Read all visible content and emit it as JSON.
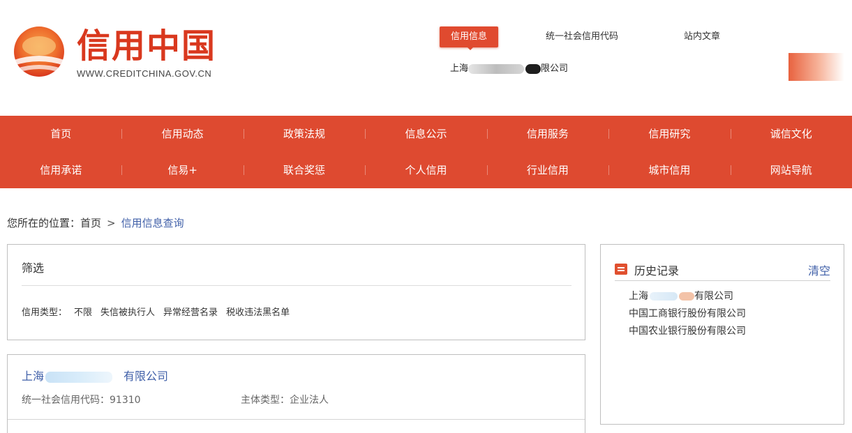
{
  "header": {
    "logo_title": "信用中国",
    "logo_url": "WWW.CREDITCHINA.GOV.CN"
  },
  "search": {
    "tabs": [
      "信用信息",
      "统一社会信用代码",
      "站内文章"
    ],
    "active_tab": 0,
    "value_prefix": "上海",
    "value_suffix": "限公司"
  },
  "nav": {
    "row1": [
      "首页",
      "信用动态",
      "政策法规",
      "信息公示",
      "信用服务",
      "信用研究",
      "诚信文化"
    ],
    "row2": [
      "信用承诺",
      "信易+",
      "联合奖惩",
      "个人信用",
      "行业信用",
      "城市信用",
      "网站导航"
    ]
  },
  "breadcrumb": {
    "prefix": "您所在的位置：",
    "home": "首页",
    "separator": ">",
    "current": "信用信息查询"
  },
  "filter": {
    "title": "筛选",
    "label": "信用类型：",
    "options": [
      "不限",
      "失信被执行人",
      "异常经营名录",
      "税收违法黑名单"
    ]
  },
  "result": {
    "name_prefix": "上海",
    "name_suffix": "有限公司",
    "code_label": "统一社会信用代码：",
    "code_value": "91310",
    "type_label": "主体类型：",
    "type_value": "企业法人"
  },
  "history": {
    "title": "历史记录",
    "clear_label": "清空",
    "item1_prefix": "上海",
    "item1_suffix": "有限公司",
    "items": [
      "中国工商银行股份有限公司",
      "中国农业银行股份有限公司"
    ]
  },
  "colors": {
    "brand_red": "#de4a30",
    "link_blue": "#3f5fa8"
  }
}
